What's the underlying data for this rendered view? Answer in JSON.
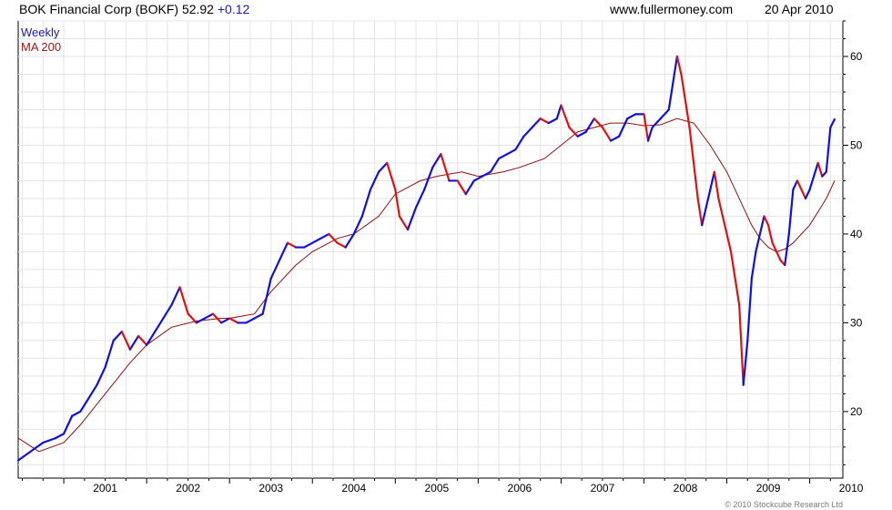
{
  "header": {
    "symbol_text": "BOK Financial Corp (BOKF) 52.92",
    "change": "+0.12",
    "site": "www.fullermoney.com",
    "date": "20 Apr 2010"
  },
  "colors": {
    "up": "#1010d8",
    "down": "#e01010",
    "ma": "#8b1010",
    "grid": "#e4e4e4",
    "axis": "#000000",
    "legend_weekly": "#1a1aa8",
    "legend_ma": "#a01818",
    "change": "#1a1ab0"
  },
  "footer": {
    "copyright": "© 2010 Stockcube Research Ltd"
  },
  "chart_data": {
    "type": "line",
    "grid": true,
    "legend_placement": "top-left",
    "legend": [
      "Weekly",
      "MA 200"
    ],
    "x_tick_labels": [
      "2001",
      "2002",
      "2003",
      "2004",
      "2005",
      "2006",
      "2007",
      "2008",
      "2009",
      "2010"
    ],
    "y_ticks": [
      20,
      30,
      40,
      50,
      60
    ],
    "ylim": [
      12.5,
      64
    ],
    "xlim": [
      2000.45,
      2010.4
    ],
    "series": [
      {
        "name": "Weekly",
        "x": [
          2000.45,
          2000.6,
          2000.75,
          2000.9,
          2001.0,
          2001.1,
          2001.2,
          2001.3,
          2001.4,
          2001.5,
          2001.6,
          2001.7,
          2001.8,
          2001.9,
          2002.0,
          2002.1,
          2002.2,
          2002.3,
          2002.4,
          2002.5,
          2002.6,
          2002.7,
          2002.8,
          2002.9,
          2003.0,
          2003.1,
          2003.2,
          2003.3,
          2003.4,
          2003.5,
          2003.6,
          2003.7,
          2003.8,
          2003.9,
          2004.0,
          2004.1,
          2004.2,
          2004.3,
          2004.4,
          2004.5,
          2004.6,
          2004.7,
          2004.8,
          2004.9,
          2005.0,
          2005.05,
          2005.15,
          2005.25,
          2005.35,
          2005.45,
          2005.55,
          2005.65,
          2005.75,
          2005.85,
          2005.95,
          2006.05,
          2006.15,
          2006.25,
          2006.35,
          2006.45,
          2006.55,
          2006.65,
          2006.75,
          2006.85,
          2006.95,
          2007.0,
          2007.1,
          2007.2,
          2007.3,
          2007.4,
          2007.5,
          2007.6,
          2007.7,
          2007.8,
          2007.9,
          2008.0,
          2008.05,
          2008.1,
          2008.2,
          2008.3,
          2008.35,
          2008.4,
          2008.45,
          2008.5,
          2008.55,
          2008.6,
          2008.65,
          2008.7,
          2008.75,
          2008.8,
          2008.85,
          2008.9,
          2008.95,
          2009.0,
          2009.05,
          2009.1,
          2009.15,
          2009.2,
          2009.25,
          2009.3,
          2009.35,
          2009.4,
          2009.45,
          2009.5,
          2009.55,
          2009.6,
          2009.65,
          2009.7,
          2009.75,
          2009.8,
          2009.85,
          2009.9,
          2009.95,
          2010.0,
          2010.05,
          2010.1,
          2010.15,
          2010.2,
          2010.25,
          2010.3
        ],
        "y": [
          14.5,
          15.5,
          16.5,
          17.0,
          17.5,
          19.5,
          20.0,
          21.5,
          23.0,
          25.0,
          28.0,
          29.0,
          27.0,
          28.5,
          27.5,
          29.0,
          30.5,
          32.0,
          34.0,
          31.0,
          30.0,
          30.5,
          31.0,
          30.0,
          30.5,
          30.0,
          30.0,
          30.5,
          31.0,
          35.0,
          37.0,
          39.0,
          38.5,
          38.5,
          39.0,
          39.5,
          40.0,
          39.0,
          38.5,
          40.0,
          42.0,
          45.0,
          47.0,
          48.0,
          45.0,
          42.0,
          40.5,
          43.0,
          45.0,
          47.5,
          49.0,
          46.0,
          46.0,
          44.5,
          46.0,
          46.5,
          47.0,
          48.5,
          49.0,
          49.5,
          51.0,
          52.0,
          53.0,
          52.5,
          53.0,
          54.5,
          52.0,
          51.0,
          51.5,
          53.0,
          52.0,
          50.5,
          51.0,
          53.0,
          53.5,
          53.5,
          50.5,
          52.0,
          53.0,
          54.0,
          57.0,
          60.0,
          58.0,
          55.0,
          52.0,
          48.0,
          44.0,
          41.0,
          43.0,
          45.0,
          47.0,
          44.0,
          42.0,
          40.0,
          38.0,
          35.0,
          32.0,
          23.0,
          28.0,
          35.0,
          38.0,
          40.0,
          42.0,
          41.0,
          39.0,
          38.0,
          37.0,
          36.5,
          40.0,
          45.0,
          46.0,
          45.0,
          44.0,
          45.0,
          46.5,
          48.0,
          46.5,
          47.0,
          52.0,
          52.92
        ]
      },
      {
        "name": "MA 200",
        "x": [
          2000.45,
          2000.7,
          2001.0,
          2001.2,
          2001.5,
          2001.8,
          2002.0,
          2002.3,
          2002.6,
          2002.9,
          2003.0,
          2003.3,
          2003.5,
          2003.8,
          2004.0,
          2004.3,
          2004.5,
          2004.8,
          2005.0,
          2005.3,
          2005.5,
          2005.8,
          2006.0,
          2006.3,
          2006.5,
          2006.8,
          2007.0,
          2007.2,
          2007.4,
          2007.6,
          2007.8,
          2008.0,
          2008.2,
          2008.4,
          2008.6,
          2008.8,
          2009.0,
          2009.1,
          2009.2,
          2009.3,
          2009.4,
          2009.5,
          2009.6,
          2009.7,
          2009.8,
          2009.9,
          2010.0,
          2010.1,
          2010.2,
          2010.3
        ],
        "y": [
          17.0,
          15.5,
          16.5,
          18.5,
          22.0,
          25.5,
          27.5,
          29.5,
          30.2,
          30.5,
          30.5,
          31.0,
          33.5,
          36.5,
          38.0,
          39.5,
          40.0,
          42.0,
          44.5,
          46.0,
          46.5,
          47.0,
          46.5,
          47.0,
          47.5,
          48.5,
          50.0,
          51.5,
          52.0,
          52.5,
          52.5,
          52.2,
          52.3,
          53.0,
          52.5,
          50.0,
          47.0,
          45.0,
          43.0,
          41.0,
          39.5,
          38.5,
          38.0,
          38.3,
          39.0,
          40.0,
          41.0,
          42.5,
          44.0,
          46.0
        ]
      }
    ]
  }
}
